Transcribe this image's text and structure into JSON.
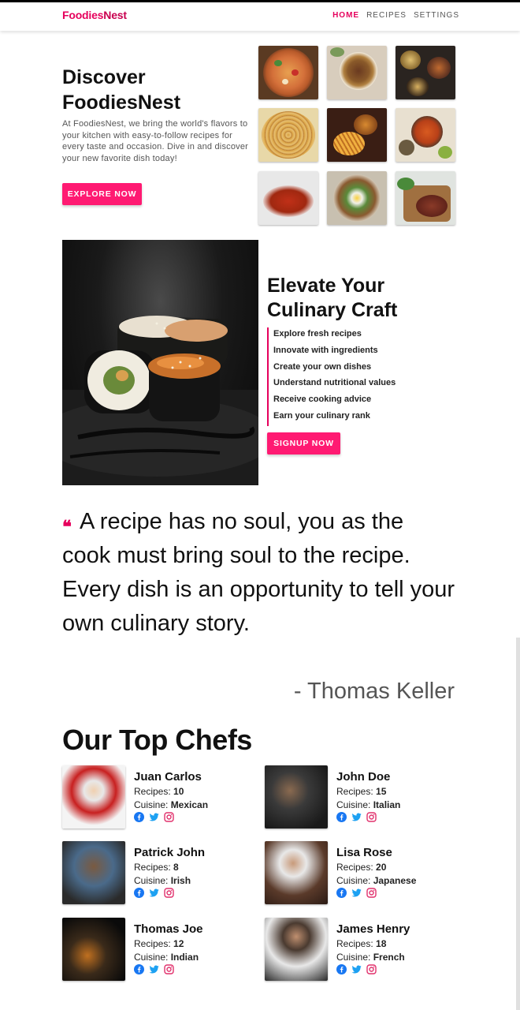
{
  "app": {
    "brand_part1": "Foodies",
    "brand_part2": "Nest",
    "accent": "#e6005c",
    "button_color": "#ff1a72"
  },
  "nav": {
    "items": [
      "HOME",
      "RECIPES",
      "SETTINGS"
    ],
    "active": "HOME"
  },
  "hero": {
    "title_line1": "Discover",
    "title_line2": "FoodiesNest",
    "text": "At FoodiesNest, we bring the world's flavors to your kitchen with easy-to-follow recipes for every taste and occasion. Dive in and discover your new favorite dish today!",
    "button": "EXPLORE NOW",
    "gallery": [
      "pizza",
      "noodle bowl",
      "asian platter",
      "spaghetti",
      "burger and fries",
      "curry spread",
      "chicken wings",
      "ramen with egg",
      "steak board"
    ]
  },
  "elevate": {
    "title_line1": "Elevate Your",
    "title_line2": "Culinary Craft",
    "features": [
      "Explore fresh recipes",
      "Innovate with ingredients",
      "Create your own dishes",
      "Understand nutritional values",
      "Receive cooking advice",
      "Earn your culinary rank"
    ],
    "button": "SIGNUP NOW"
  },
  "quote": {
    "text": "A recipe has no soul, you as the cook must bring soul to the recipe. Every dish is an opportunity to tell your own culinary story.",
    "author": "- Thomas Keller"
  },
  "chefs": {
    "title": "Our Top Chefs",
    "recipes_label": "Recipes:",
    "cuisine_label": "Cuisine:",
    "list": [
      {
        "name": "Juan Carlos",
        "recipes": "10",
        "cuisine": "Mexican"
      },
      {
        "name": "John Doe",
        "recipes": "15",
        "cuisine": "Italian"
      },
      {
        "name": "Patrick John",
        "recipes": "8",
        "cuisine": "Irish"
      },
      {
        "name": "Lisa Rose",
        "recipes": "20",
        "cuisine": "Japanese"
      },
      {
        "name": "Thomas Joe",
        "recipes": "12",
        "cuisine": "Indian"
      },
      {
        "name": "James Henry",
        "recipes": "18",
        "cuisine": "French"
      }
    ],
    "social_icons": [
      "facebook-icon",
      "twitter-icon",
      "instagram-icon"
    ],
    "social_colors": [
      "#1877f2",
      "#1da1f2",
      "#e1306c"
    ]
  }
}
